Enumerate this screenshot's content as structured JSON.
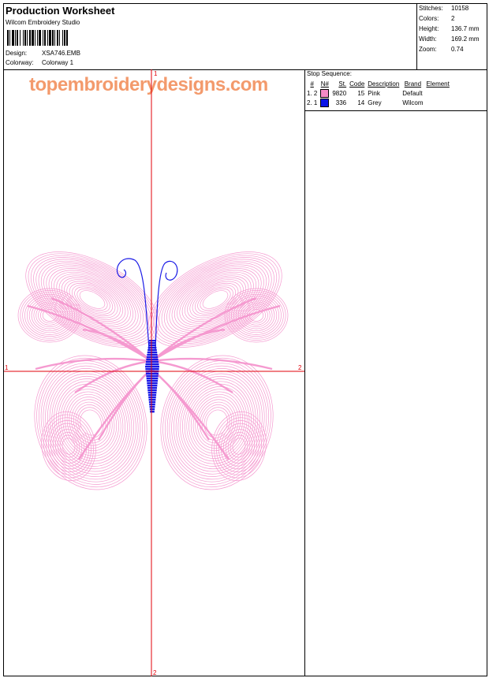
{
  "header": {
    "title": "Production Worksheet",
    "software": "Wilcom Embroidery Studio",
    "design_label": "Design:",
    "design_value": "XSA746.EMB",
    "colorway_label": "Colorway:",
    "colorway_value": "Colorway 1"
  },
  "stats": {
    "stitches_label": "Stitches:",
    "stitches_value": "10158",
    "colors_label": "Colors:",
    "colors_value": "2",
    "height_label": "Height:",
    "height_value": "136.7 mm",
    "width_label": "Width:",
    "width_value": "169.2 mm",
    "zoom_label": "Zoom:",
    "zoom_value": "0.74"
  },
  "canvas": {
    "watermark": "topembroiderydesigns.com",
    "axis_top": "1",
    "axis_left": "1",
    "axis_right": "2",
    "axis_bottom": "2",
    "colors": {
      "pink": "#f59ad0",
      "blue": "#1a1ae6",
      "axis": "#e0000a"
    }
  },
  "stop_sequence": {
    "title": "Stop Sequence:",
    "columns": [
      "#",
      "N#",
      "St.",
      "Code",
      "Description",
      "Brand",
      "Element"
    ],
    "rows": [
      {
        "num": "1. 2",
        "color": "#f58bc6",
        "stitches": "9820",
        "code": "15",
        "description": "Pink",
        "brand": "Default",
        "element": ""
      },
      {
        "num": "2. 1",
        "color": "#0a14e8",
        "stitches": "336",
        "code": "14",
        "description": "Grey",
        "brand": "Wilcom",
        "element": ""
      }
    ]
  }
}
